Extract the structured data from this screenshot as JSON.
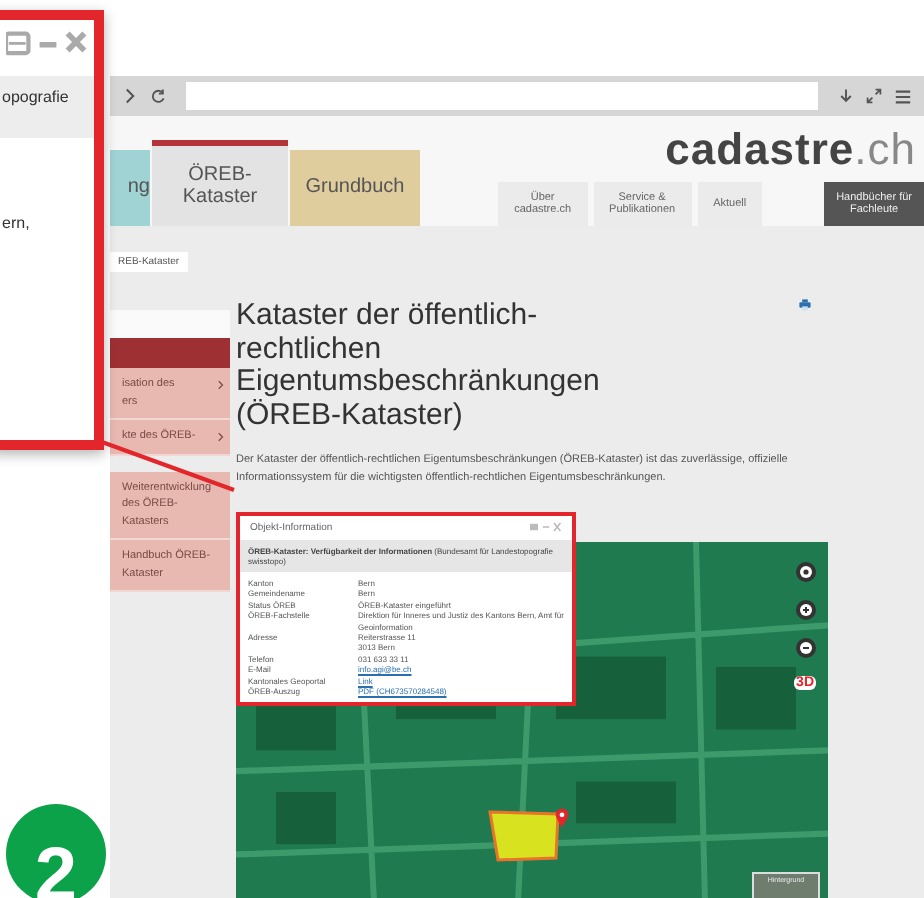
{
  "callout": {
    "band_text": "opografie",
    "body_text": "ern,"
  },
  "badge": {
    "label": "2"
  },
  "site": {
    "logo": {
      "main": "cadastre",
      "suffix": ".ch"
    },
    "main_tabs": [
      {
        "label": "ng",
        "color": "#9fd3d4",
        "selected": false
      },
      {
        "label": "ÖREB-\nKataster",
        "color": "#e3e3e3",
        "selected": true
      },
      {
        "label": "Grundbuch",
        "color": "#dfcd9e",
        "selected": false
      }
    ],
    "top_links": [
      {
        "label": "Über\ncadastre.ch",
        "kind": "link"
      },
      {
        "label": "Service &\nPublikationen",
        "kind": "link"
      },
      {
        "label": "Aktuell",
        "kind": "link"
      },
      {
        "label": "Handbücher für\nFachleute",
        "kind": "highlight"
      }
    ],
    "breadcrumb": "REB-Kataster",
    "sidebar": [
      {
        "label": "isation des\ners",
        "has_children": true
      },
      {
        "label": "kte des ÖREB-",
        "has_children": true
      },
      {
        "label": "Weiterentwicklung des ÖREB-Katasters",
        "has_children": false
      },
      {
        "label": "Handbuch ÖREB-Kataster",
        "has_children": false
      }
    ],
    "title": "Kataster der öffentlich-rechtlichen Eigentumsbeschränkungen (ÖREB-Kataster)",
    "intro": "Der Kataster der öffentlich-rechtlichen Eigentumsbeschränkungen (ÖREB-Kataster) ist das zuverlässige, offizielle Informationssystem für die wichtigsten öffentlich-rechtlichen Eigentumsbeschränkungen.",
    "popup": {
      "title": "Objekt-Information",
      "heading": "**ÖREB-Kataster: Verfügbarkeit der Informationen** (Bundesamt für Landestopografie swisstopo)",
      "rows": [
        {
          "label": "Kanton",
          "value": "Bern",
          "kind": "text"
        },
        {
          "label": "Gemeindename",
          "value": "Bern",
          "kind": "text"
        },
        {
          "label": "Status ÖREB",
          "value": "ÖREB-Kataster eingeführt",
          "kind": "text"
        },
        {
          "label": "ÖREB-Fachstelle",
          "value": "Direktion für Inneres und Justiz des Kantons Bern, Amt für Geoinformation",
          "kind": "text"
        },
        {
          "label": "Adresse",
          "value": "Reiterstrasse 11\n3013 Bern",
          "kind": "text"
        },
        {
          "label": "Telefon",
          "value": "031 633 33 11",
          "kind": "text"
        },
        {
          "label": "E-Mail",
          "value": "info.agi@be.ch",
          "kind": "link"
        },
        {
          "label": "Kantonales Geoportal",
          "value": "Link",
          "kind": "link"
        },
        {
          "label": "ÖREB-Auszug",
          "value": "PDF (CH673570284548)",
          "kind": "link"
        }
      ]
    },
    "map": {
      "control_3d": "3D",
      "background_label": "Hintergrund"
    }
  }
}
